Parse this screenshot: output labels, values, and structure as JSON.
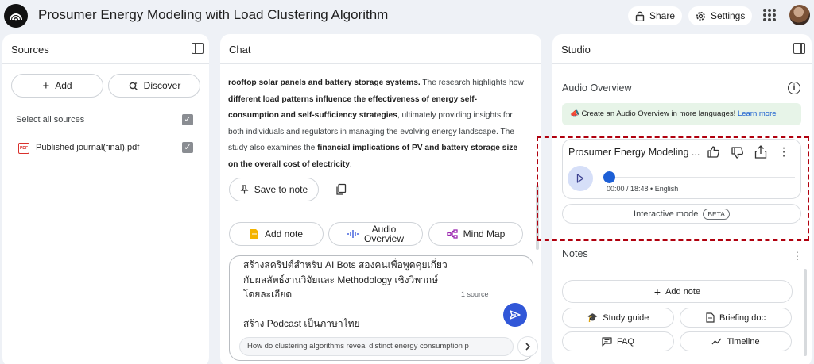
{
  "app": {
    "title": "Prosumer Energy Modeling with Load Clustering Algorithm"
  },
  "header": {
    "share_label": "Share",
    "settings_label": "Settings",
    "icons": [
      "lock-icon",
      "gear-icon",
      "apps-grid-icon"
    ]
  },
  "sources": {
    "title": "Sources",
    "add_label": "Add",
    "discover_label": "Discover",
    "select_all_label": "Select all sources",
    "select_all_checked": true,
    "items": [
      {
        "icon_text": "PDF",
        "name": "Published journal(final).pdf",
        "checked": true
      }
    ]
  },
  "chat": {
    "title": "Chat",
    "response": {
      "p1": "rooftop solar panels and battery storage systems.",
      "p2": " The research highlights how ",
      "p3": "different load patterns influence the effectiveness of energy self-consumption and self-sufficiency strategies",
      "p4": ", ultimately providing insights for both individuals and regulators in managing the evolving energy landscape. The study also examines the ",
      "p5": "financial implications of PV and battery storage size on the overall cost of electricity",
      "p6": "."
    },
    "save_to_note_label": "Save to note",
    "actions": {
      "add_note_label": "Add note",
      "audio_overview_label_1": "Audio",
      "audio_overview_label_2": "Overview",
      "mind_map_label": "Mind Map"
    },
    "input": {
      "value": "สร้างสคริปต์สำหรับ AI Bots สองคนเพื่อพูดคุยเกี่ยว\nกับผลลัพธ์งานวิจัยและ Methodology เชิงวิพากษ์\nโดยละเอียด\n\nสร้าง Podcast เป็นภาษาไทย",
      "source_count": "1 source",
      "suggestion": "How do clustering algorithms reveal distinct energy consumption p"
    }
  },
  "studio": {
    "title": "Studio",
    "audio_overview_heading": "Audio Overview",
    "banner_text": "Create an Audio Overview in more languages! ",
    "banner_link": "Learn more",
    "audio_card": {
      "title": "Prosumer Energy Modeling ...",
      "time": "00:00 / 18:48 • English",
      "progress": 0
    },
    "interactive_label": "Interactive mode",
    "beta_label": "BETA",
    "notes_heading": "Notes",
    "add_note_label": "Add note",
    "note_types": {
      "study_guide": "Study guide",
      "briefing_doc": "Briefing doc",
      "faq": "FAQ",
      "timeline": "Timeline"
    }
  },
  "colors": {
    "accent_blue": "#3157d8",
    "highlight_dashed": "#b0000e",
    "banner_bg": "#e7f4e8"
  }
}
